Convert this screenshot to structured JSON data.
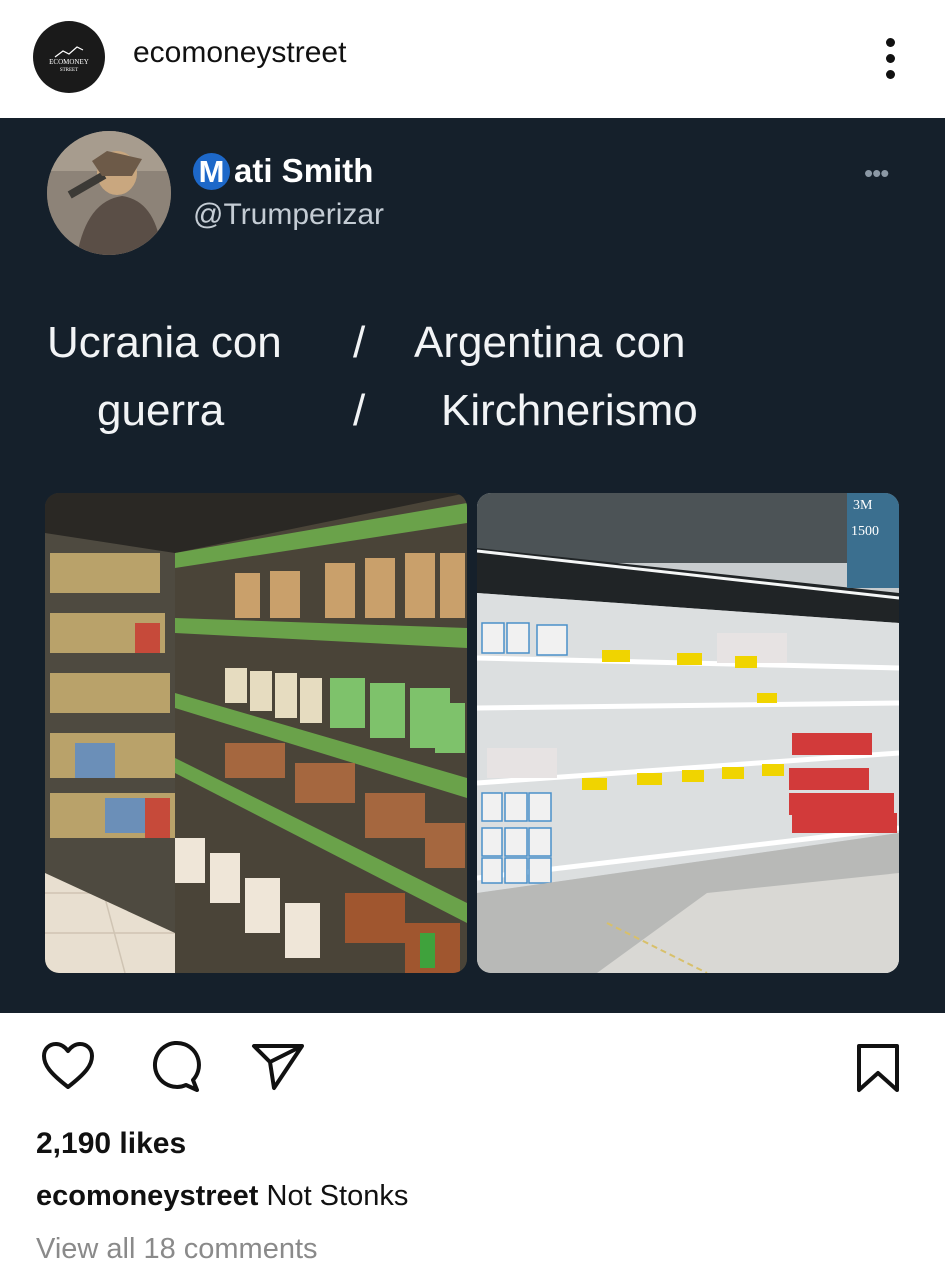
{
  "header": {
    "account_name": "ecomoneystreet",
    "avatar_text_top": "ECOMONEY",
    "avatar_text_bottom": "STREET",
    "more_icon": "vertical-dots-icon"
  },
  "tweet": {
    "display_name_initial": "M",
    "display_name_rest": "ati Smith",
    "handle": "@Trumperizar",
    "more_icon": "horizontal-dots-icon",
    "line1_left": "Ucrania con",
    "line1_sep": "/",
    "line1_right": "Argentina con",
    "line2_left": "guerra",
    "line2_sep": "/",
    "line2_right": "Kirchnerismo",
    "right_photo_sign_top": "3M",
    "right_photo_sign_price": "1500"
  },
  "actions": {
    "like_icon": "heart-icon",
    "comment_icon": "comment-icon",
    "share_icon": "send-icon",
    "save_icon": "bookmark-icon"
  },
  "likes": "2,190 likes",
  "caption": {
    "user": "ecomoneystreet",
    "text": " Not Stonks"
  },
  "comments_link": "View all 18 comments",
  "colors": {
    "tweet_background": "#15202b",
    "verified_badge": "#1d68c9"
  }
}
